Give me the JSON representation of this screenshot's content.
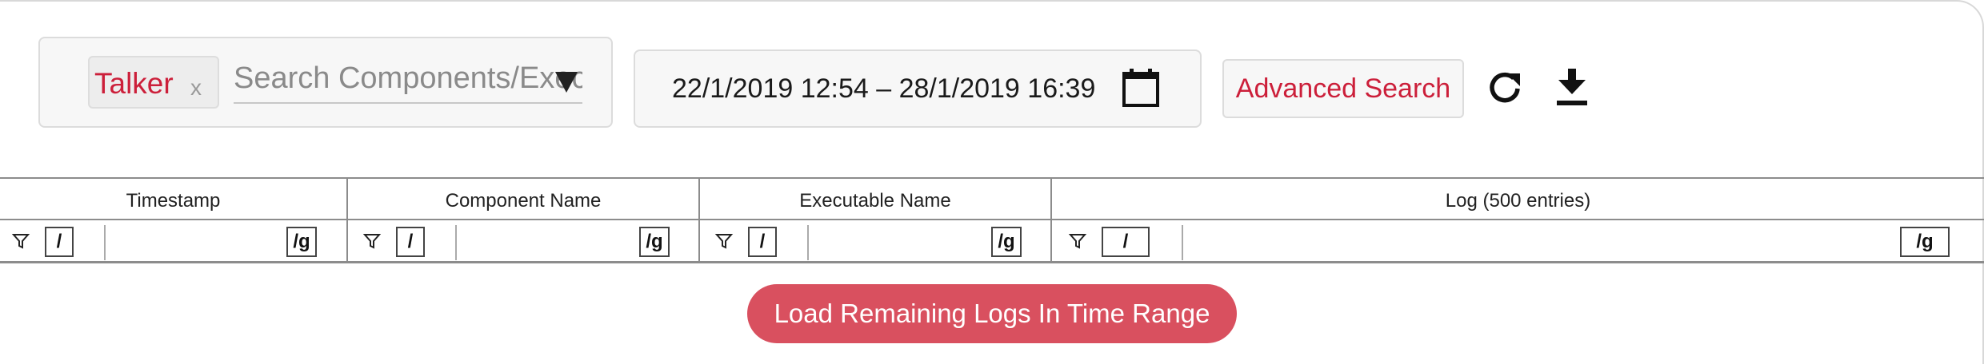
{
  "toolbar": {
    "component_tag": {
      "label": "Talker",
      "remove": "x"
    },
    "component_search": {
      "placeholder": "Search Components/Executables"
    },
    "date_range": {
      "text": "22/1/2019  12:54 – 28/1/2019  16:39"
    },
    "advanced_search_label": "Advanced Search",
    "icons": {
      "dropdown": "caret-down-icon",
      "calendar": "calendar-icon",
      "refresh": "refresh-icon",
      "download": "download-icon"
    }
  },
  "table": {
    "columns": [
      {
        "title": "Timestamp",
        "regex_open": "/",
        "regex_close": "/g"
      },
      {
        "title": "Component Name",
        "regex_open": "/",
        "regex_close": "/g"
      },
      {
        "title": "Executable Name",
        "regex_open": "/",
        "regex_close": "/g"
      },
      {
        "title": "Log (500 entries)",
        "regex_open": "/",
        "regex_close": "/g"
      }
    ],
    "filter_icon": "filter-icon"
  },
  "load_button_label": "Load Remaining Logs In Time Range",
  "colors": {
    "accent": "#cc1f3a",
    "load_button": "#d9505f",
    "border": "#8c8c8c"
  }
}
